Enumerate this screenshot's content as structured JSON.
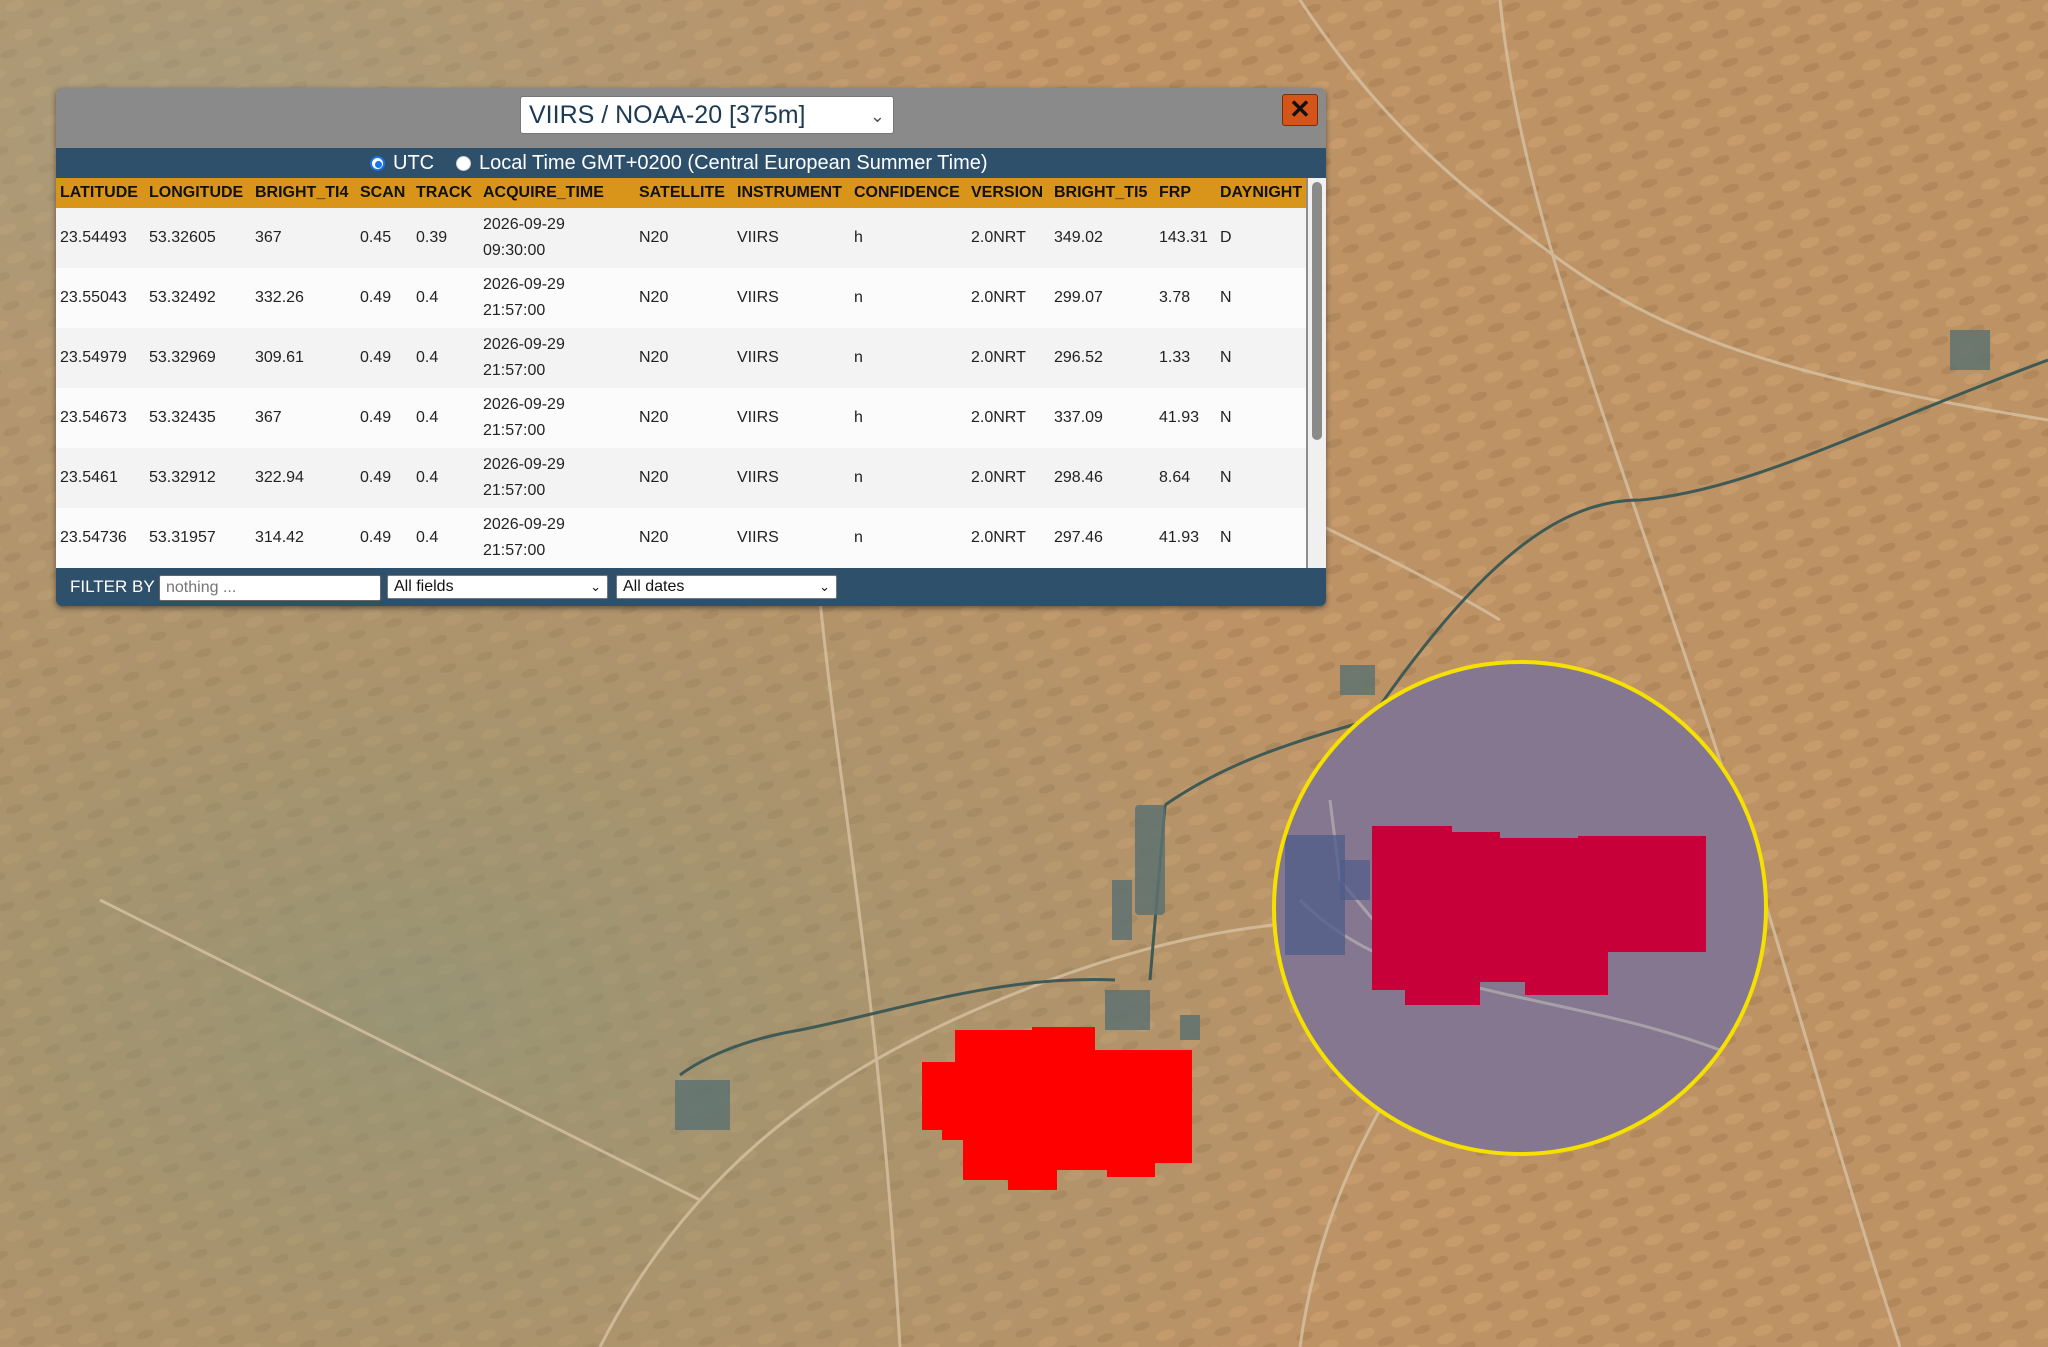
{
  "map": {
    "fire_color": "#ff0000",
    "highlight_ring_color": "#f5e000"
  },
  "panel": {
    "satellite_select": "VIIRS / NOAA-20 [375m]",
    "close_icon": "close-icon",
    "timezone": {
      "utc_label": "UTC",
      "local_label": "Local Time GMT+0200 (Central European Summer Time)",
      "selected": "UTC"
    },
    "columns": [
      "LATITUDE",
      "LONGITUDE",
      "BRIGHT_TI4",
      "SCAN",
      "TRACK",
      "ACQUIRE_TIME",
      "SATELLITE",
      "INSTRUMENT",
      "CONFIDENCE",
      "VERSION",
      "BRIGHT_TI5",
      "FRP",
      "DAYNIGHT"
    ],
    "rows": [
      {
        "latitude": "23.54493",
        "longitude": "53.32605",
        "bright_ti4": "367",
        "scan": "0.45",
        "track": "0.39",
        "date": "2026-09-29",
        "time": "09:30:00",
        "satellite": "N20",
        "instrument": "VIIRS",
        "confidence": "h",
        "version": "2.0NRT",
        "bright_ti5": "349.02",
        "frp": "143.31",
        "daynight": "D"
      },
      {
        "latitude": "23.55043",
        "longitude": "53.32492",
        "bright_ti4": "332.26",
        "scan": "0.49",
        "track": "0.4",
        "date": "2026-09-29",
        "time": "21:57:00",
        "satellite": "N20",
        "instrument": "VIIRS",
        "confidence": "n",
        "version": "2.0NRT",
        "bright_ti5": "299.07",
        "frp": "3.78",
        "daynight": "N"
      },
      {
        "latitude": "23.54979",
        "longitude": "53.32969",
        "bright_ti4": "309.61",
        "scan": "0.49",
        "track": "0.4",
        "date": "2026-09-29",
        "time": "21:57:00",
        "satellite": "N20",
        "instrument": "VIIRS",
        "confidence": "n",
        "version": "2.0NRT",
        "bright_ti5": "296.52",
        "frp": "1.33",
        "daynight": "N"
      },
      {
        "latitude": "23.54673",
        "longitude": "53.32435",
        "bright_ti4": "367",
        "scan": "0.49",
        "track": "0.4",
        "date": "2026-09-29",
        "time": "21:57:00",
        "satellite": "N20",
        "instrument": "VIIRS",
        "confidence": "h",
        "version": "2.0NRT",
        "bright_ti5": "337.09",
        "frp": "41.93",
        "daynight": "N"
      },
      {
        "latitude": "23.5461",
        "longitude": "53.32912",
        "bright_ti4": "322.94",
        "scan": "0.49",
        "track": "0.4",
        "date": "2026-09-29",
        "time": "21:57:00",
        "satellite": "N20",
        "instrument": "VIIRS",
        "confidence": "n",
        "version": "2.0NRT",
        "bright_ti5": "298.46",
        "frp": "8.64",
        "daynight": "N"
      },
      {
        "latitude": "23.54736",
        "longitude": "53.31957",
        "bright_ti4": "314.42",
        "scan": "0.49",
        "track": "0.4",
        "date": "2026-09-29",
        "time": "21:57:00",
        "satellite": "N20",
        "instrument": "VIIRS",
        "confidence": "n",
        "version": "2.0NRT",
        "bright_ti5": "297.46",
        "frp": "41.93",
        "daynight": "N"
      }
    ],
    "filter": {
      "label": "FILTER BY",
      "placeholder": "nothing ...",
      "field_select": "All fields",
      "date_select": "All dates"
    }
  }
}
